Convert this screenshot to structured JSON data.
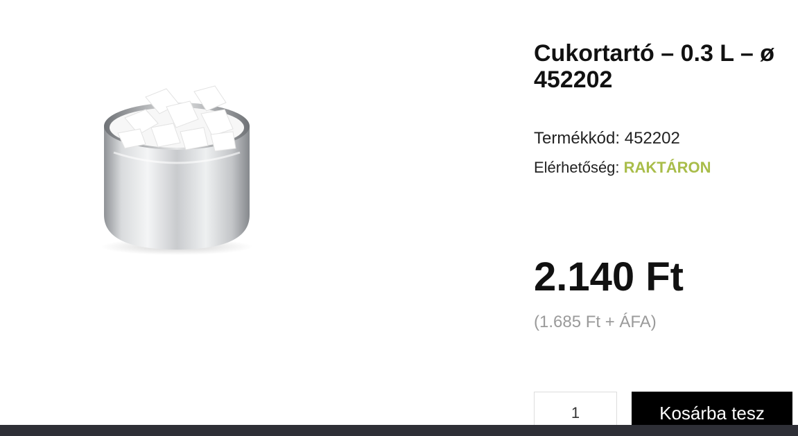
{
  "product": {
    "title_line1": "Cukortartó – 0.3 L – ø",
    "title_line2": "452202",
    "code_label": "Termékkód: ",
    "code_value": "452202",
    "availability_label": "Elérhetőség: ",
    "availability_value": "RAKTÁRON",
    "price": "2.140 Ft",
    "price_net": "(1.685 Ft + ÁFA)",
    "image_icon": "sugar-bowl-image"
  },
  "cart": {
    "quantity_value": "1",
    "add_to_cart_label": "Kosárba tesz"
  },
  "colors": {
    "stock_status": "#a9bd4a",
    "button_background": "#000000",
    "bottom_bar": "#2e2f36",
    "net_price_text": "#9a9a9a"
  }
}
